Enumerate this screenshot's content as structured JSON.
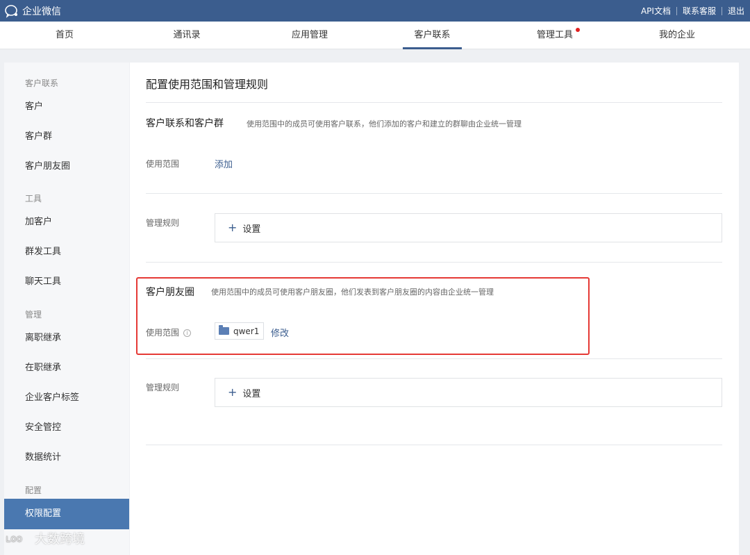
{
  "topbar": {
    "brand": "企业微信",
    "links": [
      "API文档",
      "联系客服",
      "退出"
    ]
  },
  "nav": {
    "tabs": [
      "首页",
      "通讯录",
      "应用管理",
      "客户联系",
      "管理工具",
      "我的企业"
    ],
    "active": "客户联系"
  },
  "sidebar": {
    "groups": [
      "客户联系",
      "工具",
      "管理",
      "配置"
    ],
    "items": [
      "客户",
      "客户群",
      "客户朋友圈",
      "加客户",
      "群发工具",
      "聊天工具",
      "离职继承",
      "在职继承",
      "企业客户标签",
      "安全管控",
      "数据统计",
      "权限配置"
    ],
    "active": "权限配置"
  },
  "main": {
    "title": "配置使用范围和管理规则",
    "section1": {
      "title": "客户联系和客户群",
      "desc": "使用范围中的成员可使用客户联系，他们添加的客户和建立的群聊由企业统一管理",
      "scope_label": "使用范围",
      "scope_action": "添加",
      "rule_label": "管理规则",
      "rule_action": "设置"
    },
    "section2": {
      "title": "客户朋友圈",
      "desc": "使用范围中的成员可使用客户朋友圈，他们发表到客户朋友圈的内容由企业统一管理",
      "scope_label": "使用范围",
      "scope_chip": "qwer1",
      "scope_action": "修改",
      "rule_label": "管理规则",
      "rule_action": "设置"
    }
  },
  "watermark": "大数跨境",
  "colors": {
    "topbar": "#3b5d8e",
    "accent": "#4a78b0",
    "highlight": "#e53935",
    "dot": "#e02020"
  }
}
